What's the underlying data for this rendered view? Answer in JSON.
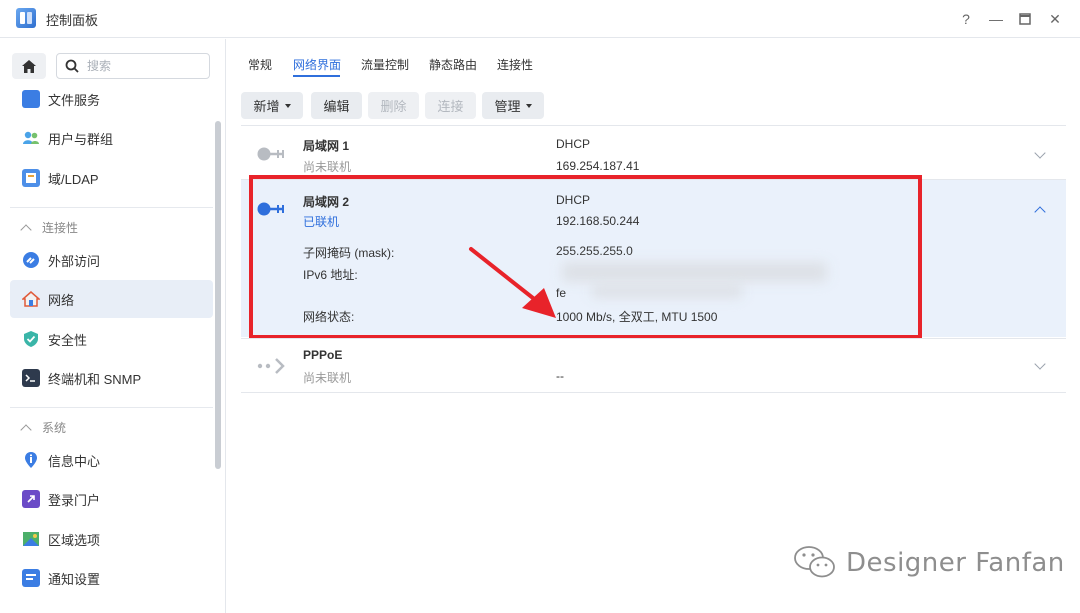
{
  "window": {
    "title": "控制面板",
    "help": "?",
    "minimize": "—",
    "maximize": "□",
    "close": "✕"
  },
  "sidebar": {
    "search_placeholder": "搜索",
    "items": [
      {
        "label": "文件服务",
        "icon": "file-service-icon"
      },
      {
        "label": "用户与群组",
        "icon": "users-icon"
      },
      {
        "label": "域/LDAP",
        "icon": "ldap-icon"
      }
    ],
    "section_connectivity": "连接性",
    "connectivity_items": [
      {
        "label": "外部访问",
        "icon": "external-access-icon"
      },
      {
        "label": "网络",
        "icon": "network-icon"
      },
      {
        "label": "安全性",
        "icon": "security-icon"
      },
      {
        "label": "终端机和 SNMP",
        "icon": "terminal-icon"
      }
    ],
    "section_system": "系统",
    "system_items": [
      {
        "label": "信息中心",
        "icon": "info-center-icon"
      },
      {
        "label": "登录门户",
        "icon": "login-portal-icon"
      },
      {
        "label": "区域选项",
        "icon": "regional-options-icon"
      },
      {
        "label": "通知设置",
        "icon": "notification-icon"
      }
    ]
  },
  "tabs": [
    "常规",
    "网络界面",
    "流量控制",
    "静态路由",
    "连接性"
  ],
  "toolbar": {
    "create": "新增",
    "edit": "编辑",
    "delete": "删除",
    "connect": "连接",
    "manage": "管理"
  },
  "interfaces": [
    {
      "name": "局域网 1",
      "status": "尚未联机",
      "mode": "DHCP",
      "ip": "169.254.187.41"
    },
    {
      "name": "局域网 2",
      "status": "已联机",
      "mode": "DHCP",
      "ip": "192.168.50.244",
      "mask_label": "子网掩码 (mask):",
      "mask_value": "255.255.255.0",
      "ipv6_label": "IPv6 地址:",
      "ipv6_value_prefix": "fe",
      "netstat_label": "网络状态:",
      "netstat_value": "1000 Mb/s, 全双工, MTU 1500"
    },
    {
      "name": "PPPoE",
      "status": "尚未联机",
      "ip": "--"
    }
  ],
  "watermark": "Designer Fanfan",
  "colors": {
    "accent": "#2f6fdc",
    "highlight_box": "#e8232a",
    "arrow": "#e8232a"
  }
}
